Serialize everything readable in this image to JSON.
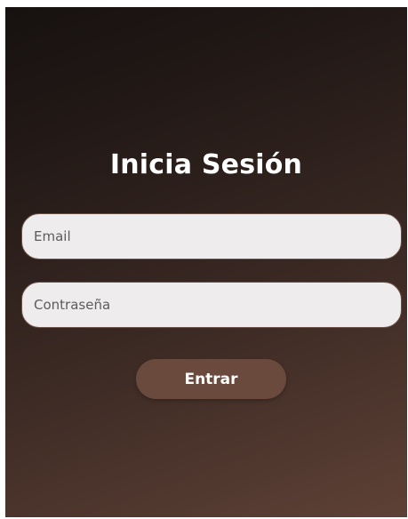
{
  "login": {
    "title": "Inicia Sesión",
    "email_placeholder": "Email",
    "email_value": "",
    "password_placeholder": "Contraseña",
    "password_value": "",
    "submit_label": "Entrar"
  },
  "colors": {
    "background_dark": "#161110",
    "background_light": "#5e4136",
    "field_background": "#eeecec",
    "button_background": "#6b4a3e",
    "title_text": "#ffffff"
  }
}
